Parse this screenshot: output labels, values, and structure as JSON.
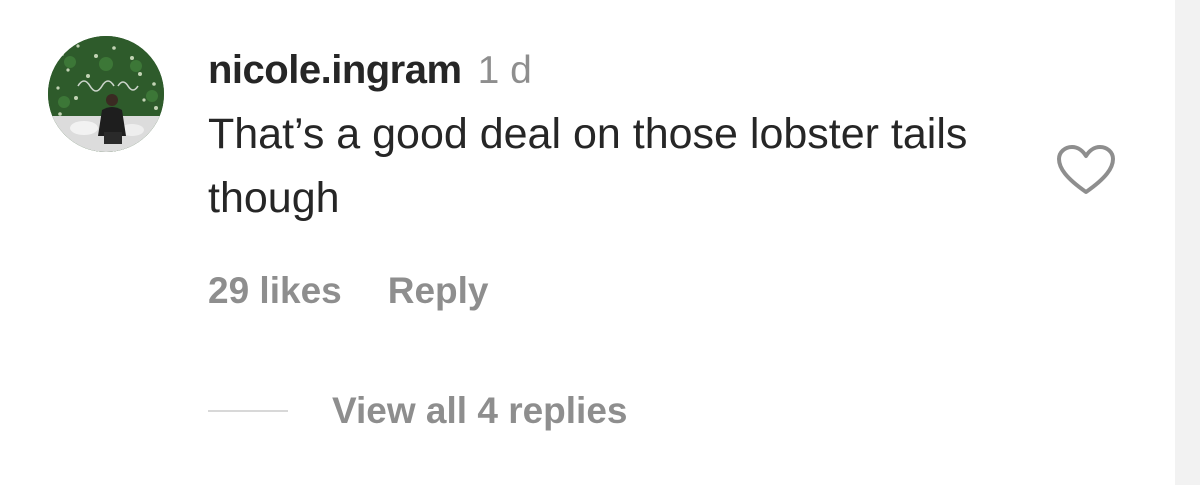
{
  "comment": {
    "username": "nicole.ingram",
    "time": "1 d",
    "text": "That’s a good deal on those lobster tails though",
    "likes": "29 likes",
    "reply_label": "Reply",
    "view_replies_label": "View all 4 replies"
  },
  "icons": {
    "like": "heart-outline-icon"
  },
  "colors": {
    "primary_text": "#262626",
    "secondary_text": "#8e8e8e"
  }
}
